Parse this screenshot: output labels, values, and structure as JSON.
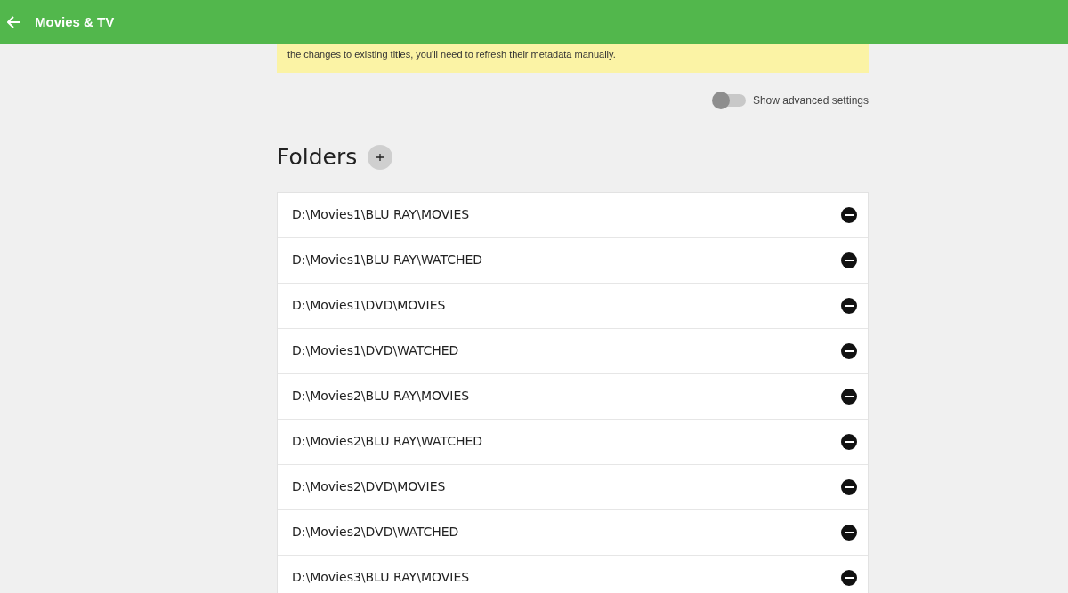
{
  "app_bar": {
    "title": "Movies & TV"
  },
  "notice": {
    "text": "the changes to existing titles, you'll need to refresh their metadata manually."
  },
  "advanced_toggle": {
    "label": "Show advanced settings",
    "on": false
  },
  "folders": {
    "title": "Folders",
    "items": [
      {
        "path": "D:\\Movies1\\BLU RAY\\MOVIES"
      },
      {
        "path": "D:\\Movies1\\BLU RAY\\WATCHED"
      },
      {
        "path": "D:\\Movies1\\DVD\\MOVIES"
      },
      {
        "path": "D:\\Movies1\\DVD\\WATCHED"
      },
      {
        "path": "D:\\Movies2\\BLU RAY\\MOVIES"
      },
      {
        "path": "D:\\Movies2\\BLU RAY\\WATCHED"
      },
      {
        "path": "D:\\Movies2\\DVD\\MOVIES"
      },
      {
        "path": "D:\\Movies2\\DVD\\WATCHED"
      },
      {
        "path": "D:\\Movies3\\BLU RAY\\MOVIES"
      }
    ]
  }
}
